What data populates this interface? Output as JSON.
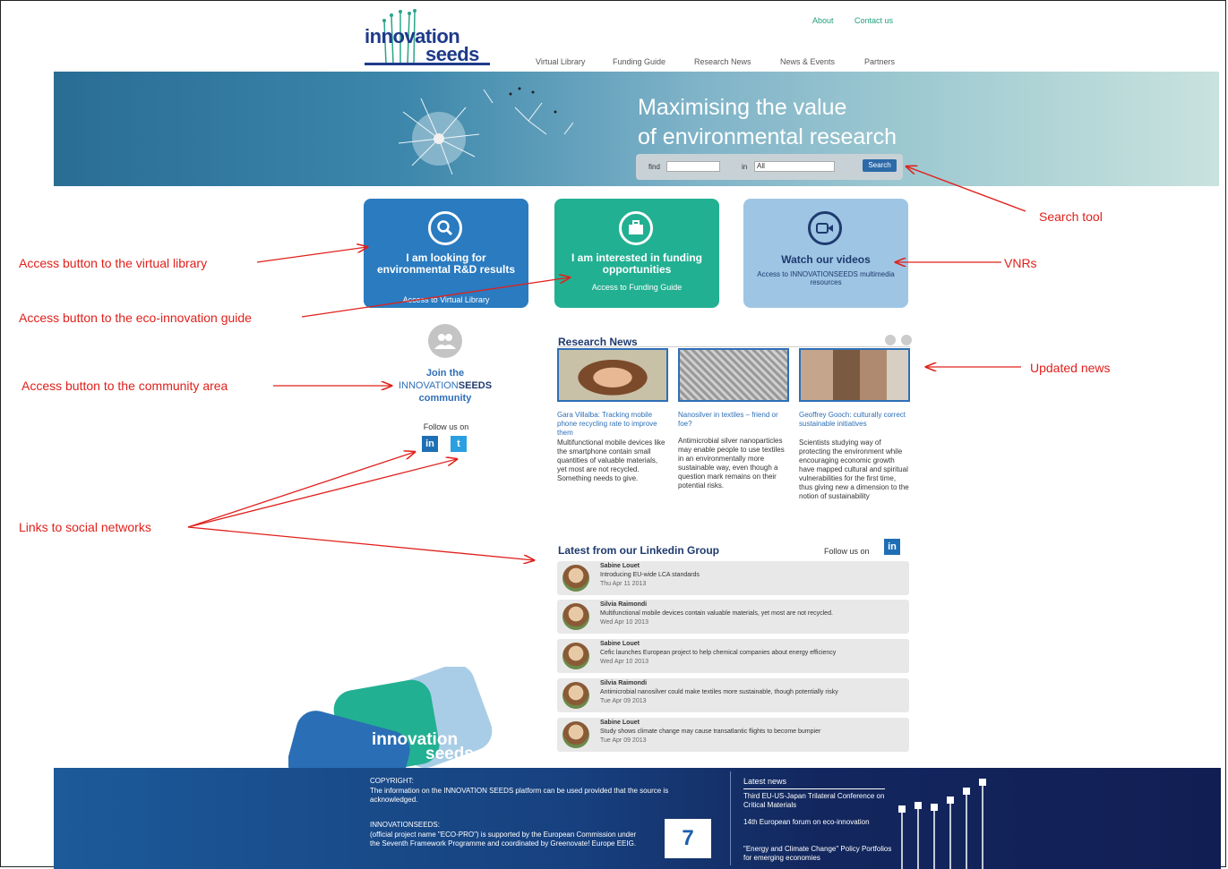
{
  "header": {
    "logo_line1": "innovation",
    "logo_line2": "seeds",
    "top_links": [
      "About",
      "Contact us"
    ],
    "nav": [
      "Virtual Library",
      "Funding Guide",
      "Research News",
      "News & Events",
      "Partners"
    ]
  },
  "banner": {
    "title_line1": "Maximising the value",
    "title_line2": "of environmental research",
    "find_label": "find",
    "in_label": "in",
    "in_value": "All",
    "search_button": "Search"
  },
  "tiles": [
    {
      "title": "I am looking for environmental R&D results",
      "subtitle": "Access to Virtual Library",
      "icon": "magnifier-icon",
      "color": "#2a7bc0"
    },
    {
      "title": "I am interested in funding opportunities",
      "subtitle": "Access to Funding Guide",
      "icon": "briefcase-icon",
      "color": "#22b092"
    },
    {
      "title": "Watch our videos",
      "subtitle": "Access to INNOVATIONSEEDS multimedia resources",
      "icon": "video-icon",
      "color": "#9ec5e4"
    }
  ],
  "community": {
    "join_line1": "Join the",
    "join_brand1": "INNOVATION",
    "join_brand2": "SEEDS",
    "join_line3": "community",
    "follow": "Follow us on"
  },
  "research_news": {
    "title": "Research News",
    "items": [
      {
        "title": "Gara Villalba: Tracking mobile phone recycling rate to improve them",
        "body": "Multifunctional mobile devices like the smartphone contain small quantities of valuable materials, yet most are not recycled. Something needs to give."
      },
      {
        "title": "Nanosilver in textiles – friend or foe?",
        "body": "Antimicrobial silver nanoparticles may enable people to use textiles in an environmentally more sustainable way, even though a question mark remains on their potential risks."
      },
      {
        "title": "Geoffrey Gooch: culturally correct sustainable initiatives",
        "body": "Scientists studying way of protecting the environment while encouraging economic growth have mapped cultural and spiritual vulnerabilities for the first time, thus giving new a dimension to the notion of sustainability"
      }
    ]
  },
  "linkedin": {
    "title": "Latest from our Linkedin Group",
    "follow": "Follow us on",
    "posts": [
      {
        "name": "Sabine Louet",
        "text": "Introducing EU-wide LCA standards",
        "date": "Thu Apr 11 2013"
      },
      {
        "name": "Silvia Raimondi",
        "text": "Multifunctional mobile devices contain valuable materials, yet most are not recycled.",
        "date": "Wed Apr 10 2013"
      },
      {
        "name": "Sabine Louet",
        "text": "Cefic launches European project to help chemical companies about energy efficiency",
        "date": "Wed Apr 10 2013"
      },
      {
        "name": "Silvia Raimondi",
        "text": "Antimicrobial nanosilver could make textiles more sustainable, though potentially risky",
        "date": "Tue Apr 09 2013"
      },
      {
        "name": "Sabine Louet",
        "text": "Study shows climate change may cause transatlantic flights to become bumpier",
        "date": "Tue Apr 09 2013"
      }
    ]
  },
  "footer": {
    "copyright_head": "COPYRIGHT:",
    "copyright_text": "The information on the INNOVATION SEEDS platform can be used provided that the source is acknowledged.",
    "project_head": "INNOVATIONSEEDS:",
    "project_text": "(official project name \"ECO-PRO\") is supported by the European Commission under the Seventh Framework Programme and coordinated by Greenovate! Europe EEIG.",
    "eu_logo": "7",
    "latest_head": "Latest news",
    "latest_items": [
      "Third EU-US-Japan Trilateral Conference on Critical Materials",
      "14th European forum on eco-innovation",
      "\"Energy and Climate Change\" Policy Portfolios for emerging economies"
    ]
  },
  "bottom_logo": {
    "line1": "innovation",
    "line2": "seeds"
  },
  "annotations": {
    "search_tool": "Search tool",
    "virtual_library": "Access button to the virtual library",
    "vnrs": "VNRs",
    "eco_guide": "Access button to the eco-innovation guide",
    "updated_news": "Updated news",
    "community": "Access button to the community area",
    "social": "Links to social networks"
  }
}
